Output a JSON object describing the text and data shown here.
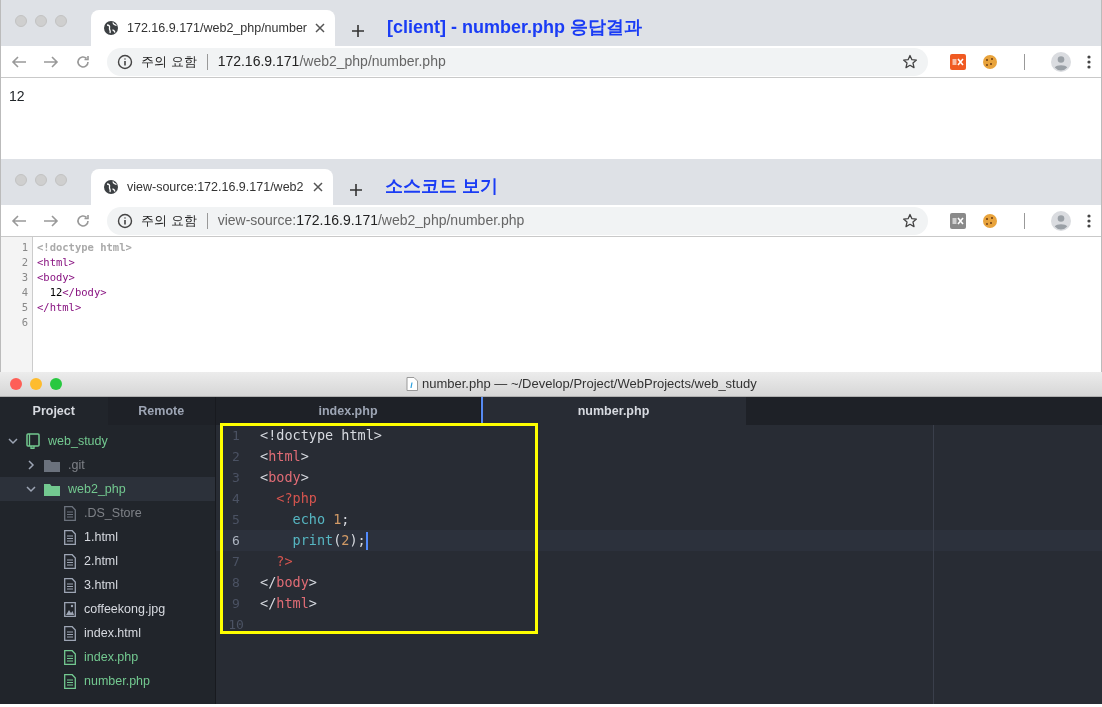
{
  "browsers": [
    {
      "tab": {
        "title": "172.16.9.171/web2_php/number",
        "selected": true
      },
      "annotation": "[client] - number.php 응답결과",
      "security_label": "주의 요함",
      "url": {
        "host": "172.16.9.171",
        "path": "/web2_php/number.php"
      },
      "extension_active": true,
      "content": {
        "kind": "page",
        "text": "12"
      }
    },
    {
      "tab": {
        "title": "view-source:172.16.9.171/web2",
        "selected": true
      },
      "annotation": "소스코드 보기",
      "security_label": "주의 요함",
      "url": {
        "prefix": "view-source:",
        "host": "172.16.9.171",
        "path": "/web2_php/number.php"
      },
      "extension_active": false,
      "content": {
        "kind": "source",
        "lines": [
          {
            "number": "1",
            "parts": [
              {
                "text": "<!doctype html>",
                "kind": "doctype"
              }
            ]
          },
          {
            "number": "2",
            "parts": [
              {
                "text": "<html>",
                "kind": "tag"
              }
            ]
          },
          {
            "number": "3",
            "parts": [
              {
                "text": "<body>",
                "kind": "tag"
              }
            ]
          },
          {
            "number": "4",
            "parts": [
              {
                "text": "  12",
                "kind": "text"
              },
              {
                "text": "</body>",
                "kind": "tag"
              }
            ]
          },
          {
            "number": "5",
            "parts": [
              {
                "text": "</html>",
                "kind": "tag"
              }
            ]
          },
          {
            "number": "6"
          }
        ]
      }
    }
  ],
  "editor": {
    "title": "number.php — ~/Develop/Project/WebProjects/web_study",
    "panel_tabs": [
      {
        "label": "Project",
        "selected": true
      },
      {
        "label": "Remote",
        "selected": false
      }
    ],
    "tree": [
      {
        "label": "web_study",
        "kind": "project",
        "added": true,
        "ignored": false,
        "expanded": true,
        "selected": false,
        "children": [
          {
            "label": ".git",
            "kind": "folder",
            "added": false,
            "ignored": true,
            "expanded": false,
            "selected": false
          },
          {
            "label": "web2_php",
            "kind": "folder",
            "added": true,
            "ignored": false,
            "expanded": true,
            "selected": true,
            "children": [
              {
                "label": ".DS_Store",
                "kind": "file",
                "added": false,
                "ignored": true,
                "selected": false
              },
              {
                "label": "1.html",
                "kind": "file",
                "added": false,
                "ignored": false,
                "selected": false
              },
              {
                "label": "2.html",
                "kind": "file",
                "added": false,
                "ignored": false,
                "selected": false
              },
              {
                "label": "3.html",
                "kind": "file",
                "added": false,
                "ignored": false,
                "selected": false
              },
              {
                "label": "coffeekong.jpg",
                "kind": "image",
                "added": false,
                "ignored": false,
                "selected": false
              },
              {
                "label": "index.html",
                "kind": "file",
                "added": false,
                "ignored": false,
                "selected": false
              },
              {
                "label": "index.php",
                "kind": "file",
                "added": true,
                "ignored": false,
                "selected": false
              },
              {
                "label": "number.php",
                "kind": "file",
                "added": true,
                "ignored": false,
                "selected": false
              }
            ]
          }
        ]
      }
    ],
    "tabs": [
      {
        "label": "index.php",
        "selected": false
      },
      {
        "label": "number.php",
        "selected": true
      }
    ],
    "lines": [
      {
        "number": "1",
        "current": false,
        "tokens": [
          {
            "text": "<!doctype html>",
            "kind": "punct"
          }
        ]
      },
      {
        "number": "2",
        "current": false,
        "tokens": [
          {
            "text": "<",
            "kind": "punct"
          },
          {
            "text": "html",
            "kind": "tag"
          },
          {
            "text": ">",
            "kind": "punct"
          }
        ]
      },
      {
        "number": "3",
        "current": false,
        "tokens": [
          {
            "text": "<",
            "kind": "punct"
          },
          {
            "text": "body",
            "kind": "tag"
          },
          {
            "text": ">",
            "kind": "punct"
          }
        ]
      },
      {
        "number": "4",
        "current": false,
        "tokens": [
          {
            "text": "  <?php",
            "kind": "php"
          }
        ]
      },
      {
        "number": "5",
        "current": false,
        "tokens": [
          {
            "text": "    echo",
            "kind": "keyword"
          },
          {
            "text": " 1",
            "kind": "number"
          },
          {
            "text": ";",
            "kind": "punct"
          }
        ]
      },
      {
        "number": "6",
        "current": true,
        "tokens": [
          {
            "text": "    print",
            "kind": "keyword"
          },
          {
            "text": "(",
            "kind": "punct"
          },
          {
            "text": "2",
            "kind": "number"
          },
          {
            "text": ");",
            "kind": "punct"
          }
        ]
      },
      {
        "number": "7",
        "current": false,
        "tokens": [
          {
            "text": "  ?>",
            "kind": "php"
          }
        ]
      },
      {
        "number": "8",
        "current": false,
        "tokens": [
          {
            "text": "</",
            "kind": "punct"
          },
          {
            "text": "body",
            "kind": "tag"
          },
          {
            "text": ">",
            "kind": "punct"
          }
        ]
      },
      {
        "number": "9",
        "current": false,
        "tokens": [
          {
            "text": "</",
            "kind": "punct"
          },
          {
            "text": "html",
            "kind": "tag"
          },
          {
            "text": ">",
            "kind": "punct"
          }
        ]
      },
      {
        "number": "10",
        "current": false
      }
    ]
  }
}
